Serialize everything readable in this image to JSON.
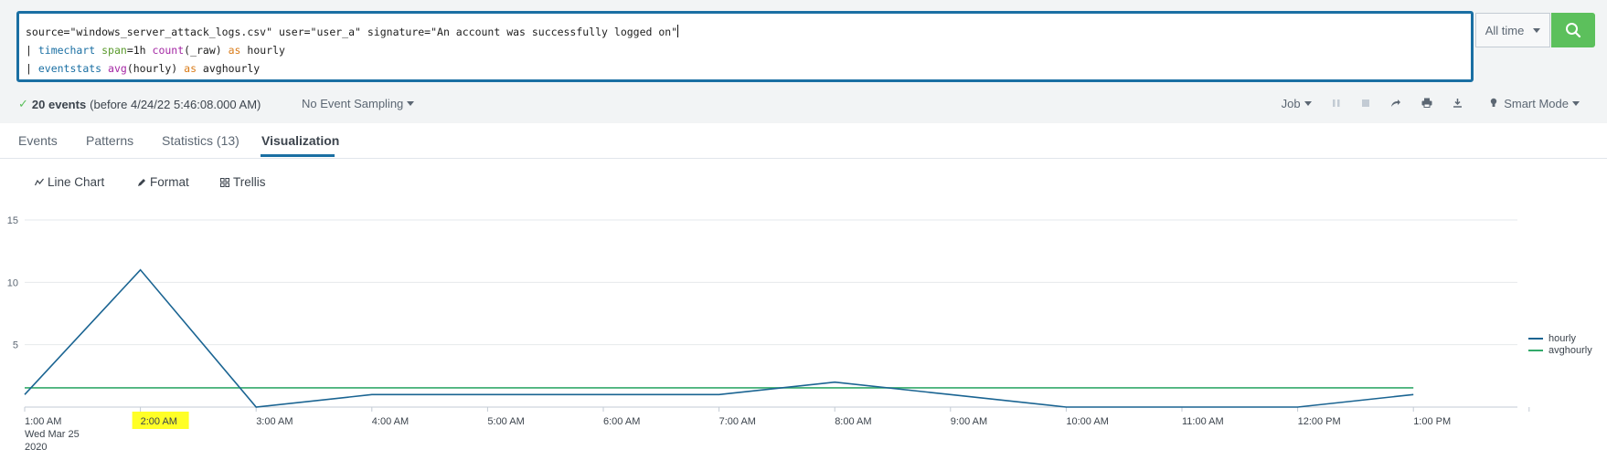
{
  "search": {
    "line1": "source=\"windows_server_attack_logs.csv\" user=\"user_a\" signature=\"An account was successfully logged on\"",
    "line2": {
      "pipe": "| ",
      "cmd": "timechart",
      "arg": "span",
      "argval": "=1h ",
      "fn": "count",
      "fnargs": "(_raw) ",
      "as": "as",
      "rest": " hourly"
    },
    "line3": {
      "pipe": "| ",
      "cmd": "eventstats",
      "fn": "avg",
      "fnargs": "(hourly) ",
      "as": "as",
      "rest": " avghourly"
    }
  },
  "time_picker": {
    "label": "All time"
  },
  "status": {
    "events": "20 events",
    "before": "(before 4/24/22 5:46:08.000 AM)",
    "sampling": "No Event Sampling"
  },
  "job": {
    "label": "Job",
    "mode": "Smart Mode"
  },
  "tabs": [
    {
      "label": "Events"
    },
    {
      "label": "Patterns"
    },
    {
      "label": "Statistics (13)"
    },
    {
      "label": "Visualization"
    }
  ],
  "viz_toolbar": {
    "chart_type": "Line Chart",
    "format": "Format",
    "trellis": "Trellis"
  },
  "colors": {
    "hourly": "#1a6492",
    "avghourly": "#32a96a",
    "accent": "#1a6fa3",
    "search_button": "#5cc05c"
  },
  "chart_data": {
    "type": "line",
    "x": [
      "1:00 AM",
      "2:00 AM",
      "3:00 AM",
      "4:00 AM",
      "5:00 AM",
      "6:00 AM",
      "7:00 AM",
      "8:00 AM",
      "9:00 AM",
      "10:00 AM",
      "11:00 AM",
      "12:00 PM",
      "1:00 PM"
    ],
    "x_first_sub": [
      "Wed Mar 25",
      "2020"
    ],
    "series": [
      {
        "name": "hourly",
        "values": [
          1,
          11,
          0,
          1,
          1,
          1,
          1,
          2,
          1,
          0,
          0,
          0,
          1
        ]
      },
      {
        "name": "avghourly",
        "values": [
          1.54,
          1.54,
          1.54,
          1.54,
          1.54,
          1.54,
          1.54,
          1.54,
          1.54,
          1.54,
          1.54,
          1.54,
          1.54
        ]
      }
    ],
    "yticks": [
      "5",
      "10",
      "15"
    ],
    "ylim": [
      0,
      15
    ],
    "grid": true,
    "legend": "right",
    "highlighted_tick": "2:00 AM"
  }
}
